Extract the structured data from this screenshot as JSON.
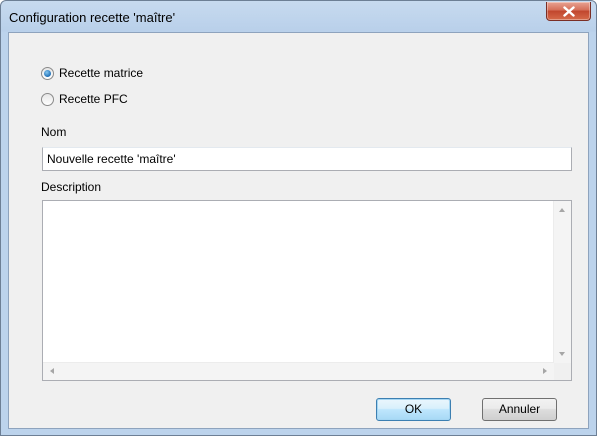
{
  "window": {
    "title": "Configuration recette 'maître'"
  },
  "recipe_type": {
    "options": [
      {
        "label": "Recette matrice",
        "checked": true
      },
      {
        "label": "Recette PFC",
        "checked": false
      }
    ]
  },
  "name_field": {
    "label": "Nom",
    "value": "Nouvelle recette 'maître'"
  },
  "description_field": {
    "label": "Description",
    "value": ""
  },
  "buttons": {
    "ok": "OK",
    "cancel": "Annuler"
  },
  "colors": {
    "title_bar": "#b9d0ea",
    "close_button": "#c1462e",
    "dialog_background": "#f0f0f0",
    "default_button_border": "#3c7fb1"
  }
}
